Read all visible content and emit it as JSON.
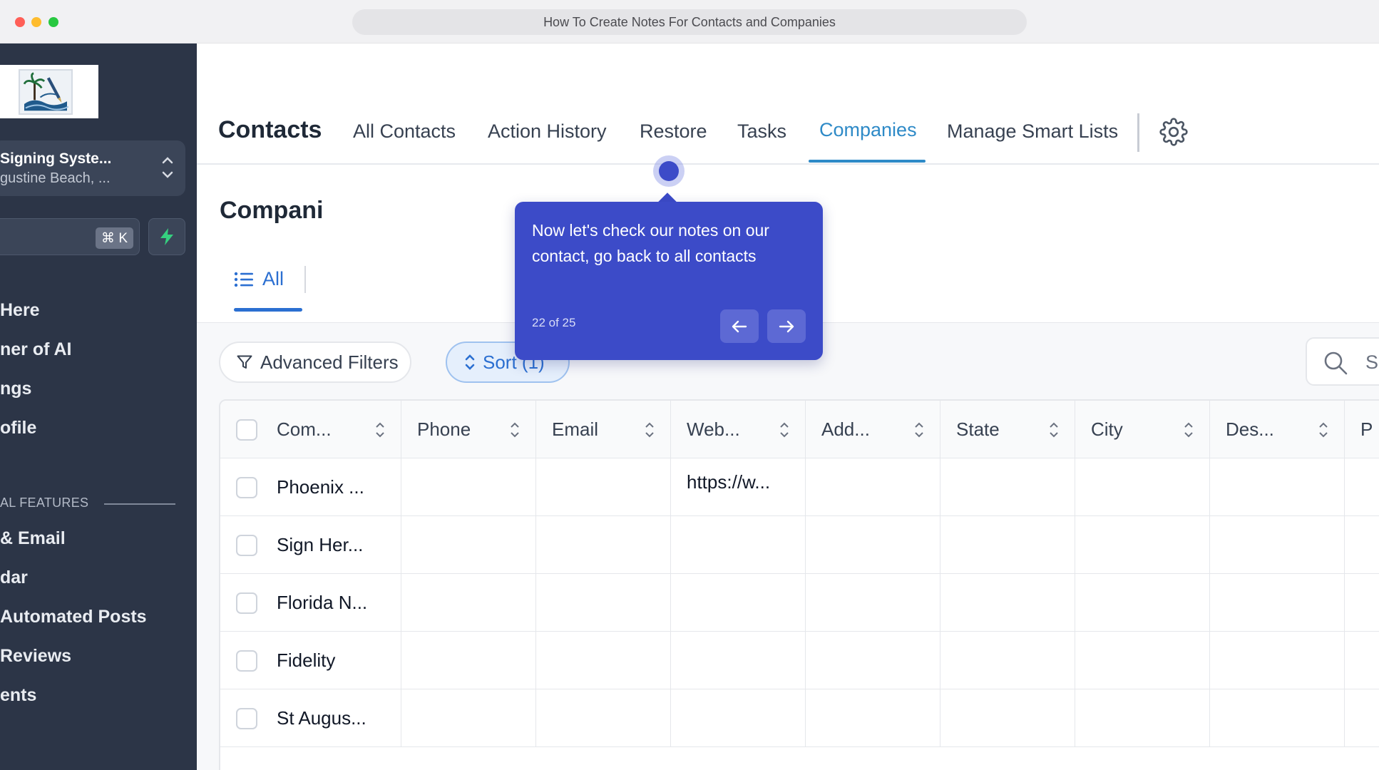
{
  "browser": {
    "title": "How To Create Notes For Contacts and Companies"
  },
  "sidebar": {
    "account_name": "Signing Syste...",
    "account_sub": "gustine Beach, ...",
    "search_shortcut": "⌘ K",
    "items": [
      {
        "label": "Here"
      },
      {
        "label": "ner of AI"
      },
      {
        "label": "ngs"
      },
      {
        "label": "ofile"
      },
      {
        "label": "& Email"
      },
      {
        "label": "dar"
      },
      {
        "label": "Automated Posts"
      },
      {
        "label": "Reviews"
      },
      {
        "label": "ents"
      }
    ],
    "section_label": "AL FEATURES"
  },
  "topnav": {
    "title": "Contacts",
    "tabs": [
      {
        "label": "All Contacts"
      },
      {
        "label": "Action History"
      },
      {
        "label": "Restore"
      },
      {
        "label": "Tasks"
      },
      {
        "label": "Companies"
      },
      {
        "label": "Manage Smart Lists"
      }
    ],
    "active_tab": "Companies"
  },
  "page": {
    "section_title": "Compani",
    "subtab_all": "All",
    "advanced_filters": "Advanced Filters",
    "sort_label": "Sort (1)",
    "search_placeholder": "S"
  },
  "table": {
    "columns": [
      "Com...",
      "Phone",
      "Email",
      "Web...",
      "Add...",
      "State",
      "City",
      "Des...",
      "P"
    ],
    "rows": [
      [
        "Phoenix ...",
        "",
        "",
        "https://w...",
        "",
        "",
        "",
        "",
        ""
      ],
      [
        "Sign Her...",
        "",
        "",
        "",
        "",
        "",
        "",
        "",
        ""
      ],
      [
        "Florida N...",
        "",
        "",
        "",
        "",
        "",
        "",
        "",
        ""
      ],
      [
        "Fidelity",
        "",
        "",
        "",
        "",
        "",
        "",
        "",
        ""
      ],
      [
        "St Augus...",
        "",
        "",
        "",
        "",
        "",
        "",
        "",
        ""
      ]
    ]
  },
  "tooltip": {
    "text": "Now let's check our notes on our contact, go back to all contacts",
    "step": "22 of 25"
  },
  "colors": {
    "sidebar_bg": "#2c3547",
    "accent": "#2e8ac7",
    "tooltip_bg": "#3c4bc8",
    "primary_blue": "#2b6fd1"
  }
}
